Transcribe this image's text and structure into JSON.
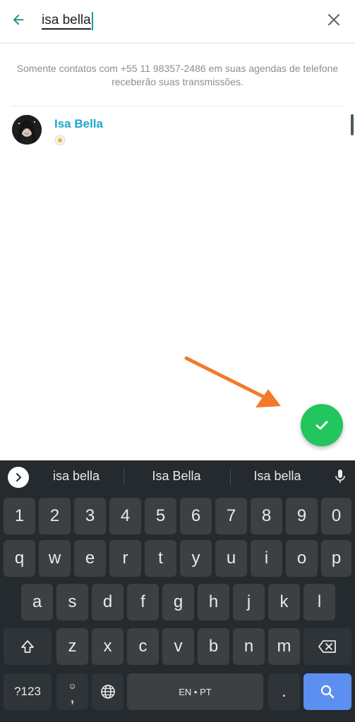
{
  "search": {
    "query": "isa bella"
  },
  "info_text": "Somente contatos com +55 11 98357-2486 em suas agendas de telefone receberão suas transmissões.",
  "contact": {
    "name": "Isa Bella",
    "status_emoji": "🍳"
  },
  "colors": {
    "accent": "#1aa7c9",
    "fab": "#22c55e",
    "arrow": "#f47a2a",
    "keyboard_bg": "#242a2e",
    "search_key": "#5d8ff0"
  },
  "keyboard": {
    "suggestions": [
      "isa bella",
      "Isa Bella",
      "Isa bella"
    ],
    "row_numbers": [
      "1",
      "2",
      "3",
      "4",
      "5",
      "6",
      "7",
      "8",
      "9",
      "0"
    ],
    "row1": [
      "q",
      "w",
      "e",
      "r",
      "t",
      "y",
      "u",
      "i",
      "o",
      "p"
    ],
    "row2": [
      "a",
      "s",
      "d",
      "f",
      "g",
      "h",
      "j",
      "k",
      "l"
    ],
    "row3": [
      "z",
      "x",
      "c",
      "v",
      "b",
      "n",
      "m"
    ],
    "symbols_label": "?123",
    "comma_label": ",",
    "emoji_hint": "☺",
    "space_label": "EN • PT",
    "period_label": "."
  }
}
